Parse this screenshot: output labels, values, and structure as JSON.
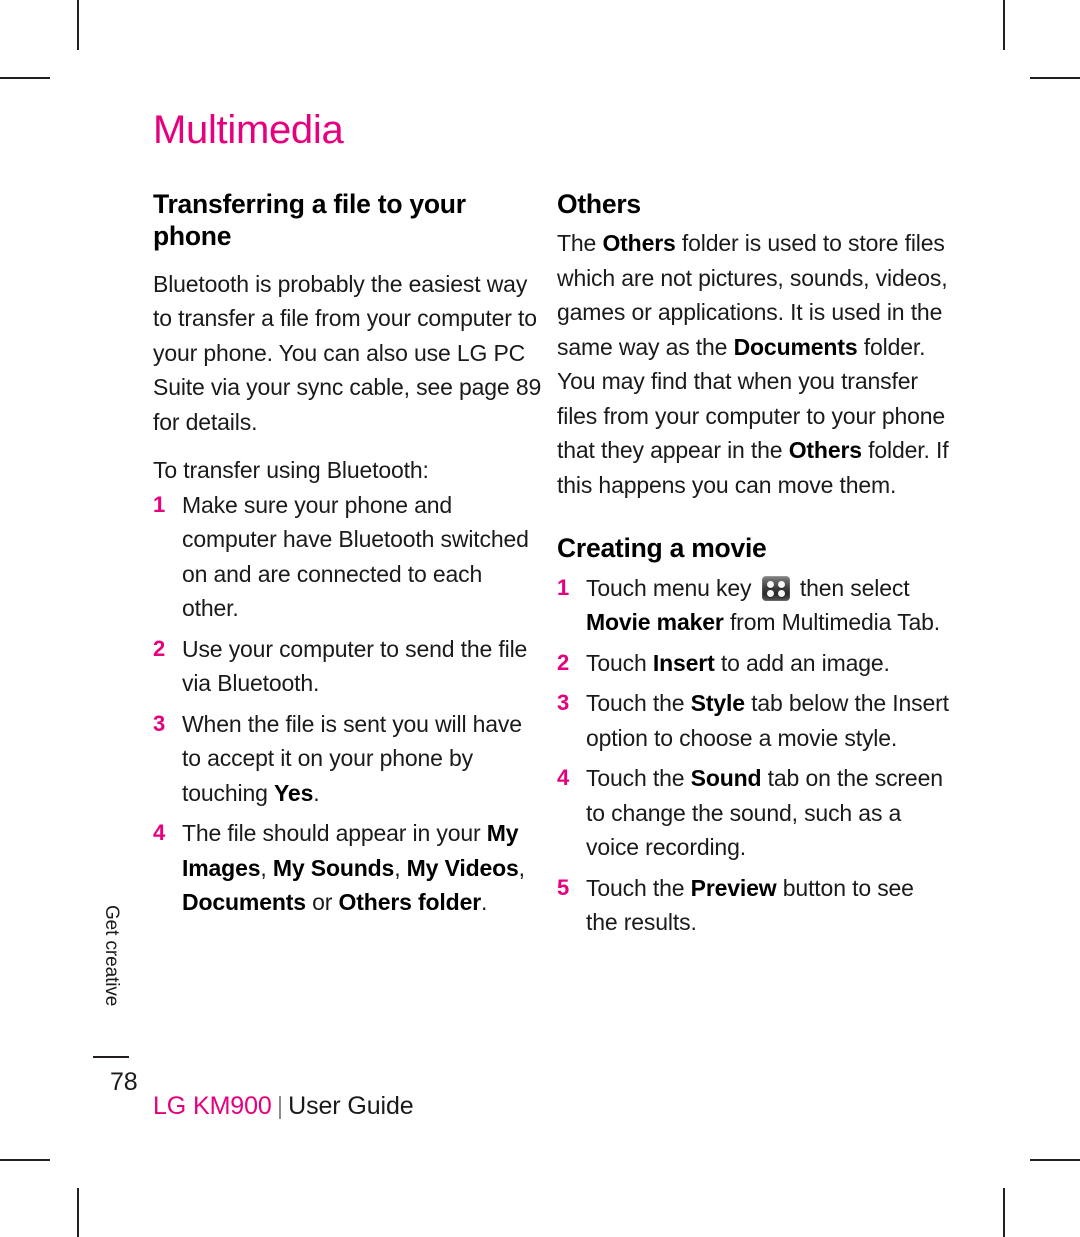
{
  "document": {
    "chapter_title": "Multimedia",
    "side_tab": "Get creative",
    "page_number": "78",
    "footer": {
      "brand": "LG KM900",
      "separator": "|",
      "doc_type": "User Guide"
    },
    "colors": {
      "accent_pink": "#E6007E",
      "body_text": "#1a1a1a",
      "separator_grey": "#8d8d8d"
    }
  },
  "left_column": {
    "heading": "Transferring a file to your phone",
    "intro_paragraph": "Bluetooth is probably the easiest way to transfer a file from your computer to your phone. You can also use LG PC Suite via your sync cable, see page 89 for details.",
    "lead_in": "To transfer using Bluetooth:",
    "steps": [
      {
        "number": "1",
        "parts": [
          {
            "text": "Make sure your phone and computer have Bluetooth switched on and are connected to each other.",
            "bold": false
          }
        ]
      },
      {
        "number": "2",
        "parts": [
          {
            "text": "Use your computer to send the file via Bluetooth.",
            "bold": false
          }
        ]
      },
      {
        "number": "3",
        "parts": [
          {
            "text": "When the file is sent you will have to accept it on your phone by touching ",
            "bold": false
          },
          {
            "text": "Yes",
            "bold": true
          },
          {
            "text": ".",
            "bold": false
          }
        ]
      },
      {
        "number": "4",
        "parts": [
          {
            "text": "The file should appear in your ",
            "bold": false
          },
          {
            "text": "My Images",
            "bold": true
          },
          {
            "text": ", ",
            "bold": false
          },
          {
            "text": "My Sounds",
            "bold": true
          },
          {
            "text": ", ",
            "bold": false
          },
          {
            "text": "My Videos",
            "bold": true
          },
          {
            "text": ", ",
            "bold": false
          },
          {
            "text": "Documents",
            "bold": true
          },
          {
            "text": " or ",
            "bold": false
          },
          {
            "text": "Others folder",
            "bold": true
          },
          {
            "text": ".",
            "bold": false
          }
        ]
      }
    ]
  },
  "right_column": {
    "others": {
      "heading": "Others",
      "paragraph_parts": [
        {
          "text": "The ",
          "bold": false
        },
        {
          "text": "Others",
          "bold": true
        },
        {
          "text": " folder is used to store files which are not pictures, sounds, videos, games or applications. It is used in the same way as the ",
          "bold": false
        },
        {
          "text": "Documents",
          "bold": true
        },
        {
          "text": " folder. You may find that when you transfer files from your computer to your phone that they appear in the ",
          "bold": false
        },
        {
          "text": "Others",
          "bold": true
        },
        {
          "text": " folder. If this happens you can move them.",
          "bold": false
        }
      ]
    },
    "creating_movie": {
      "heading": "Creating a movie",
      "menu_key_icon": "menu-key-icon",
      "steps": [
        {
          "number": "1",
          "parts": [
            {
              "text": "Touch menu key ",
              "bold": false
            },
            {
              "icon": "menu-key-icon"
            },
            {
              "text": " then select ",
              "bold": false
            },
            {
              "text": "Movie maker",
              "bold": true
            },
            {
              "text": " from Multimedia Tab.",
              "bold": false
            }
          ]
        },
        {
          "number": "2",
          "parts": [
            {
              "text": "Touch ",
              "bold": false
            },
            {
              "text": "Insert",
              "bold": true
            },
            {
              "text": " to add an image.",
              "bold": false
            }
          ]
        },
        {
          "number": "3",
          "parts": [
            {
              "text": "Touch the ",
              "bold": false
            },
            {
              "text": "Style",
              "bold": true
            },
            {
              "text": " tab below the Insert option to choose a movie style.",
              "bold": false
            }
          ]
        },
        {
          "number": "4",
          "parts": [
            {
              "text": "Touch the ",
              "bold": false
            },
            {
              "text": "Sound",
              "bold": true
            },
            {
              "text": " tab on the screen to change the sound, such as a voice recording.",
              "bold": false
            }
          ]
        },
        {
          "number": "5",
          "parts": [
            {
              "text": "Touch the ",
              "bold": false
            },
            {
              "text": "Preview",
              "bold": true
            },
            {
              "text": " button to see the results.",
              "bold": false
            }
          ]
        }
      ]
    }
  }
}
